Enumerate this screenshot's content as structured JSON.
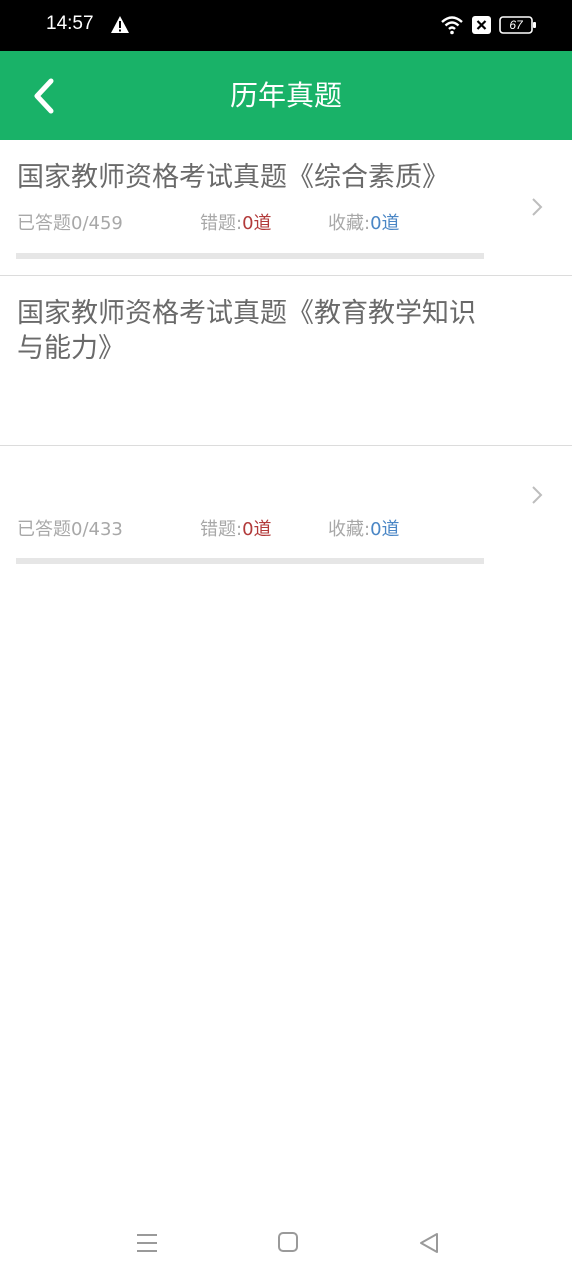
{
  "status_bar": {
    "time": "14:57",
    "battery": "67",
    "icons": [
      "warning-icon",
      "wifi-icon",
      "sim-blocked-icon",
      "battery-icon"
    ]
  },
  "app_bar": {
    "title": "历年真题",
    "back_icon": "chevron-left-icon",
    "color": "#19b268"
  },
  "exams": [
    {
      "title": "国家教师资格考试真题《综合素质》",
      "answered_label": "已答题",
      "answered_value": "0/459",
      "wrong_label": "错题:",
      "wrong_value": "0道",
      "favorite_label": "收藏:",
      "favorite_value": "0道",
      "progress": 0
    },
    {
      "title": "国家教师资格考试真题《教育教学知识与能力》",
      "answered_label": "已答题",
      "answered_value": "0/433",
      "wrong_label": "错题:",
      "wrong_value": "0道",
      "favorite_label": "收藏:",
      "favorite_value": "0道",
      "progress": 0
    }
  ],
  "colors": {
    "wrong": "#b23a3a",
    "favorite": "#4a86c5",
    "title_text": "#6a6a6a"
  },
  "nav_bar": {
    "icons": [
      "menu-icon",
      "home-square-icon",
      "back-triangle-icon"
    ]
  }
}
